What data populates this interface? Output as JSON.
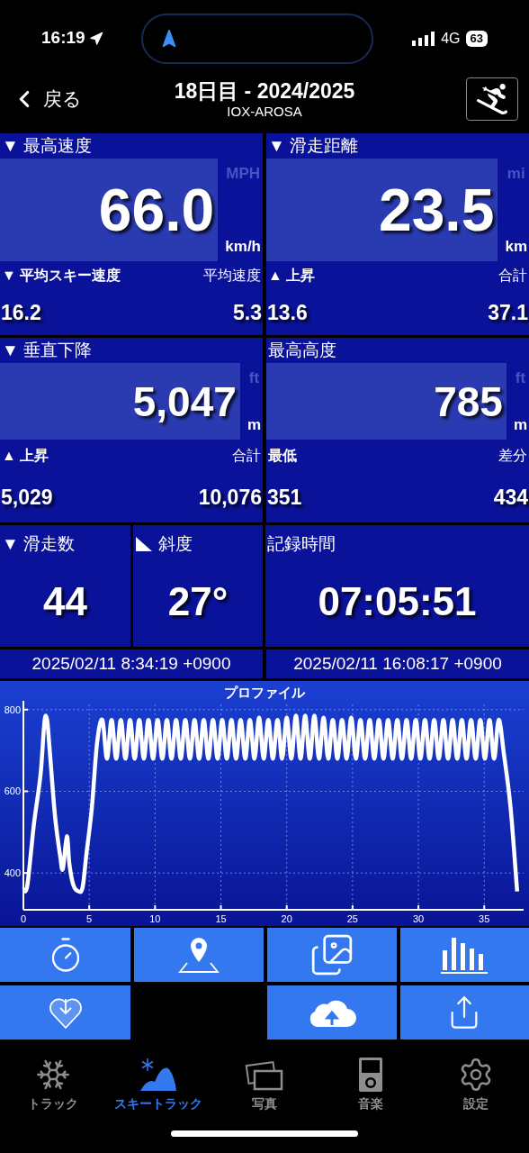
{
  "status_bar": {
    "time": "16:19",
    "network": "4G",
    "battery": "63"
  },
  "header": {
    "back": "戻る",
    "title": "18日目 - 2024/2025",
    "subtitle": "IOX-AROSA"
  },
  "stats": [
    {
      "label": "▼ 最高速度",
      "value": "66.0",
      "unit_alt": "MPH",
      "unit": "km/h",
      "sub_left_label": "▼ 平均スキー速度",
      "sub_right_label": "平均速度",
      "sub_left_value": "16.2",
      "sub_right_value": "5.3"
    },
    {
      "label": "▼ 滑走距離",
      "value": "23.5",
      "unit_alt": "mi",
      "unit": "km",
      "sub_left_label": "▲ 上昇",
      "sub_right_label": "合計",
      "sub_left_value": "13.6",
      "sub_right_value": "37.1"
    },
    {
      "label": "▼ 垂直下降",
      "value": "5,047",
      "unit_alt": "ft",
      "unit": "m",
      "sub_left_label": "▲ 上昇",
      "sub_right_label": "合計",
      "sub_left_value": "5,029",
      "sub_right_value": "10,076"
    },
    {
      "label": "最高高度",
      "value": "785",
      "unit_alt": "ft",
      "unit": "m",
      "sub_left_label": "最低",
      "sub_right_label": "差分",
      "sub_left_value": "351",
      "sub_right_value": "434"
    }
  ],
  "counters": [
    {
      "kind": "plain",
      "label": "▼ 滑走数",
      "value": "44"
    },
    {
      "kind": "slope",
      "label": "斜度",
      "value": "27°"
    },
    {
      "kind": "plain",
      "label": "記録時間",
      "value": "07:05:51"
    }
  ],
  "times": [
    "2025/02/11 8:34:19 +0900",
    "2025/02/11 16:08:17 +0900"
  ],
  "profile": {
    "chart_data": {
      "type": "line",
      "title": "プロファイル",
      "xlim": [
        0,
        38.4
      ],
      "ylim": [
        310,
        826
      ],
      "xticks": [
        0,
        5,
        10,
        15,
        20,
        25,
        30,
        35
      ],
      "yticks": [
        400,
        600,
        800
      ],
      "grid": true,
      "x": [
        0,
        0.3,
        0.8,
        1.3,
        1.6,
        1.8,
        2.0,
        2.4,
        2.8,
        3.0,
        3.3,
        3.5,
        3.8,
        4.2,
        4.5,
        4.8,
        5.2,
        5.6,
        6.0,
        6.35,
        6.7,
        7.05,
        7.4,
        7.75,
        8.1,
        8.45,
        8.8,
        9.15,
        9.5,
        9.85,
        10.2,
        10.55,
        10.9,
        11.25,
        11.6,
        11.95,
        12.3,
        12.65,
        13.0,
        13.35,
        13.7,
        14.05,
        14.4,
        14.75,
        15.1,
        15.45,
        15.8,
        16.15,
        16.5,
        16.85,
        17.2,
        17.55,
        17.9,
        18.25,
        18.6,
        18.95,
        19.3,
        19.65,
        20.0,
        20.35,
        20.7,
        21.05,
        21.4,
        21.75,
        22.1,
        22.45,
        22.8,
        23.15,
        23.5,
        23.85,
        24.2,
        24.55,
        24.9,
        25.25,
        25.6,
        25.95,
        26.3,
        26.65,
        27.0,
        27.35,
        27.7,
        28.05,
        28.4,
        28.75,
        29.1,
        29.45,
        29.8,
        30.15,
        30.5,
        30.85,
        31.2,
        31.55,
        31.9,
        32.25,
        32.6,
        32.95,
        33.3,
        33.65,
        34.0,
        34.35,
        34.7,
        35.05,
        35.4,
        35.75,
        36.1,
        36.5,
        37.0,
        37.5
      ],
      "series": [
        {
          "color": "#ffffff",
          "values": [
            360,
            370,
            520,
            640,
            770,
            775,
            700,
            540,
            440,
            410,
            490,
            420,
            370,
            355,
            365,
            450,
            560,
            720,
            775,
            680,
            775,
            680,
            775,
            680,
            775,
            680,
            775,
            680,
            775,
            680,
            775,
            680,
            775,
            680,
            775,
            680,
            775,
            680,
            775,
            680,
            775,
            680,
            775,
            680,
            775,
            680,
            775,
            680,
            775,
            680,
            775,
            680,
            780,
            680,
            775,
            680,
            775,
            680,
            780,
            680,
            785,
            680,
            785,
            680,
            785,
            680,
            780,
            680,
            775,
            680,
            775,
            680,
            780,
            680,
            775,
            680,
            775,
            680,
            775,
            680,
            775,
            680,
            775,
            680,
            775,
            680,
            775,
            680,
            775,
            680,
            775,
            680,
            775,
            680,
            775,
            680,
            775,
            680,
            775,
            680,
            775,
            680,
            775,
            680,
            775,
            690,
            560,
            355
          ]
        }
      ]
    }
  },
  "tabs": [
    {
      "label": "トラック",
      "selected": false
    },
    {
      "label": "スキートラック",
      "selected": true
    },
    {
      "label": "写真",
      "selected": false
    },
    {
      "label": "音楽",
      "selected": false
    },
    {
      "label": "設定",
      "selected": false
    }
  ]
}
